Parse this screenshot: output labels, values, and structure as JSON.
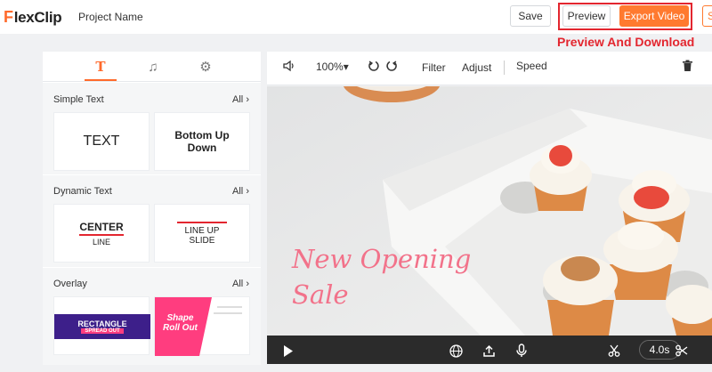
{
  "app": {
    "logo_mark": "F",
    "logo_text": "lexClip",
    "project_name": "Project Name"
  },
  "header": {
    "save_label": "Save",
    "preview_label": "Preview",
    "export_label": "Export Video",
    "extra_label": "S"
  },
  "annotation": "Preview And Download",
  "left_panel": {
    "tabs": [
      {
        "name": "text",
        "icon": "text-icon",
        "glyph": "T",
        "active": true
      },
      {
        "name": "music",
        "icon": "music-icon",
        "glyph": "♫",
        "active": false
      },
      {
        "name": "settings",
        "icon": "gear-icon",
        "glyph": "⚙",
        "active": false
      }
    ],
    "sections": [
      {
        "title": "Simple Text",
        "all_label": "All",
        "cards": [
          {
            "line1": "TEXT",
            "line2": ""
          },
          {
            "line1": "Bottom Up",
            "line2": "Down"
          }
        ]
      },
      {
        "title": "Dynamic Text",
        "all_label": "All",
        "cards": [
          {
            "line1": "CENTER",
            "line2": "LINE"
          },
          {
            "line1": "LINE UP",
            "line2": "SLIDE"
          }
        ]
      },
      {
        "title": "Overlay",
        "all_label": "All",
        "cards": [
          {
            "line1": "RECTANGLE",
            "line2": "SPREAD OUT"
          },
          {
            "line1": "Shape",
            "line2": "Roll Out"
          }
        ]
      }
    ]
  },
  "editor_toolbar": {
    "zoom": "100%",
    "filter_label": "Filter",
    "adjust_label": "Adjust",
    "speed_label": "Speed"
  },
  "canvas": {
    "line1": "New Opening",
    "line2": "Sale"
  },
  "controls": {
    "duration": "4.0s"
  },
  "colors": {
    "accent": "#ff7a2f",
    "annotation": "#e3262f",
    "overlay_purple": "#3d1f8a",
    "overlay_pink": "#ff3d7f",
    "text_pink": "#f2728a"
  }
}
